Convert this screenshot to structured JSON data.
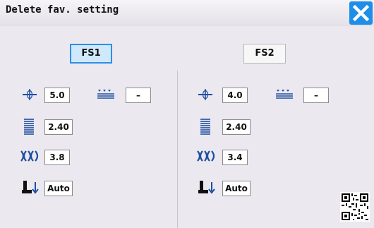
{
  "window": {
    "title": "Delete fav. setting"
  },
  "tabs": [
    {
      "label": "FS1",
      "selected": true
    },
    {
      "label": "FS2",
      "selected": false
    }
  ],
  "panels": [
    {
      "stitch_width": "5.0",
      "feed_dog": "–",
      "stitch_length": "2.40",
      "thread_tension": "3.8",
      "presser_foot_pressure": "Auto"
    },
    {
      "stitch_width": "4.0",
      "feed_dog": "–",
      "stitch_length": "2.40",
      "thread_tension": "3.4",
      "presser_foot_pressure": "Auto"
    }
  ],
  "colors": {
    "accent": "#1f8ee8",
    "selected_tab_fill": "#cfe8fb",
    "background": "#ece8ef"
  },
  "icons": [
    "close-icon",
    "stitch-width-icon",
    "feed-dog-icon",
    "stitch-length-icon",
    "thread-tension-icon",
    "presser-foot-pressure-icon",
    "qr-code-icon"
  ]
}
